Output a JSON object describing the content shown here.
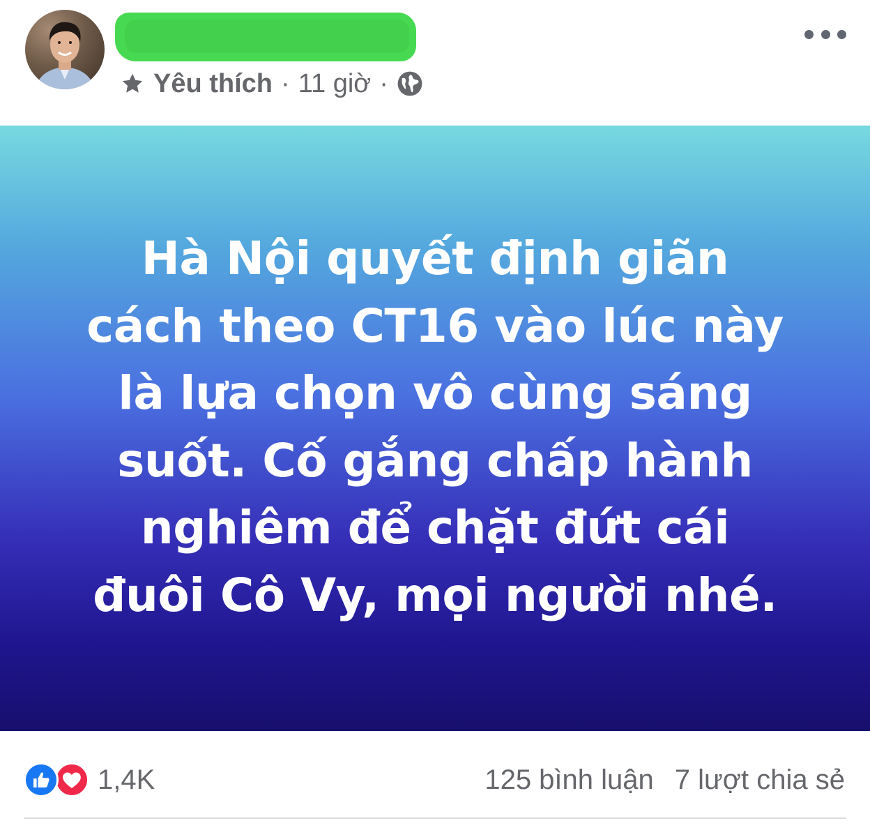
{
  "header": {
    "favorite_label": "Yêu thích",
    "separator": "·",
    "time": "11 giờ"
  },
  "post": {
    "text_lines": [
      "Hà Nội quyết định giãn",
      "cách theo CT16 vào lúc này",
      "là lựa chọn vô cùng sáng",
      "suốt. Cố gắng chấp hành",
      "nghiêm để chặt đứt cái",
      "đuôi Cô Vy, mọi người nhé."
    ],
    "background_colors": [
      "#77d9df",
      "#4a6fe0",
      "#170f6d"
    ]
  },
  "footer": {
    "reaction_count": "1,4K",
    "comments": "125 bình luận",
    "shares": "7 lượt chia sẻ"
  },
  "icons": [
    "star-icon",
    "globe-icon",
    "more-options-icon",
    "like-reaction-icon",
    "love-reaction-icon"
  ]
}
